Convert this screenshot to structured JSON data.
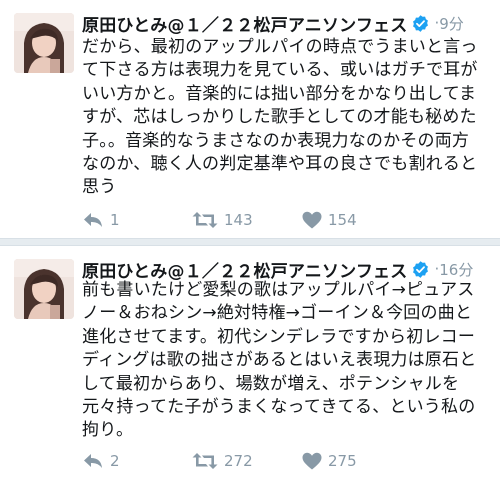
{
  "tweets": [
    {
      "author": "原田ひとみ@１／２２松戸アニソンフェス",
      "time": "9分",
      "separator": "·",
      "text_lines": [
        "だから、最初のアップルパイの時点でうまいと言っ",
        "て下さる方は表現力を見ている、或いはガチで耳が",
        "いい方かと。音楽的には拙い部分をかなり出してま",
        "すが、芯はしっかりした歌手としての才能も秘めた",
        "子。。音楽的なうまさなのか表現力なのかその両方",
        "なのか、聴く人の判定基準や耳の良さでも割れると",
        "思う"
      ],
      "replies": "1",
      "retweets": "143",
      "likes": "154"
    },
    {
      "author": "原田ひとみ@１／２２松戸アニソンフェス",
      "time": "16分",
      "separator": "·",
      "text_lines": [
        "前も書いたけど愛梨の歌はアップルパイ→ピュアス",
        "ノー＆おねシン→絶対特権→ゴーイン＆今回の曲と",
        "進化させてます。初代シンデレラですから初レコー",
        "ディングは歌の拙さがあるとはいえ表現力は原石と",
        "して最初からあり、場数が増え、ポテンシャルを",
        "元々持ってた子がうまくなってきてる、という私の",
        "拘り。"
      ],
      "replies": "2",
      "retweets": "272",
      "likes": "275"
    }
  ],
  "icons": {
    "verified": "verified-badge-icon",
    "reply": "reply-icon",
    "retweet": "retweet-icon",
    "like": "heart-icon"
  },
  "colors": {
    "verified": "#1da1f2",
    "muted": "#8899a6",
    "text": "#14171a",
    "separator": "#e6ecf0"
  }
}
